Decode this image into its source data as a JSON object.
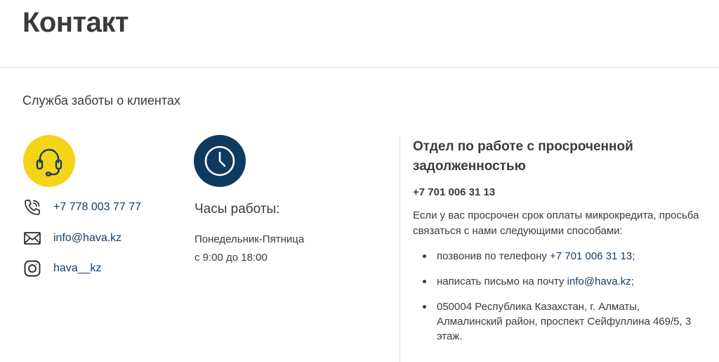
{
  "page": {
    "title": "Контакт"
  },
  "customer_care": {
    "title": "Служба заботы о клиентах",
    "phone": "+7 778 003 77 77",
    "email": "info@hava.kz",
    "instagram": "hava__kz"
  },
  "hours": {
    "title": "Часы работы:",
    "days": "Понедельник-Пятница",
    "time": "с 9:00 до 18:00"
  },
  "debt": {
    "title": "Отдел по работе с просроченной задолженностью",
    "phone": "+7 701 006 31 13",
    "note": "Если у вас просрочен срок оплаты микрокредита, просьба связаться с нами следующими способами:",
    "items": [
      {
        "prefix": "позвонив по телефону ",
        "link": "+7 701 006 31 13",
        "suffix": ";"
      },
      {
        "prefix": "написать письмо на почту ",
        "link": "info@hava.kz",
        "suffix": ";"
      },
      {
        "text": "050004 Республика Казахстан, г. Алматы, Алмалинский район, проспект Сейфуллина 469/5, 3 этаж."
      }
    ]
  },
  "colors": {
    "support_circle": "#f3d417",
    "clock_circle": "#0e3a5f",
    "link": "#163c62"
  },
  "icons": [
    "headset-icon",
    "clock-icon",
    "phone-icon",
    "mail-icon",
    "instagram-icon"
  ]
}
